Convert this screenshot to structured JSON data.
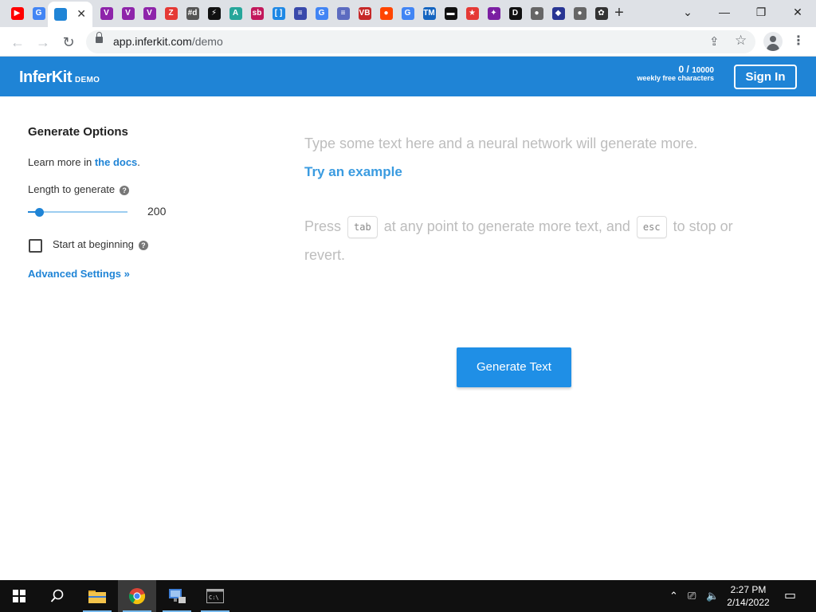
{
  "browser": {
    "url_domain": "app.inferkit.com",
    "url_path": "/demo",
    "tabs": [
      {
        "icon": "youtube-icon",
        "glyph": "▶",
        "color": "#ff0000"
      },
      {
        "icon": "google-icon",
        "glyph": "G",
        "color": "#4285f4"
      },
      {
        "icon": "inferkit-icon",
        "glyph": "",
        "color": "#1f84d6",
        "active": true
      },
      {
        "icon": "v-icon",
        "glyph": "V",
        "color": "#8e24aa"
      },
      {
        "icon": "v-icon",
        "glyph": "V",
        "color": "#8e24aa"
      },
      {
        "icon": "v-icon",
        "glyph": "V",
        "color": "#8e24aa"
      },
      {
        "icon": "z-icon",
        "glyph": "Z",
        "color": "#e53935"
      },
      {
        "icon": "hashtag-icon",
        "glyph": "#d",
        "color": "#555"
      },
      {
        "icon": "bolt-icon",
        "glyph": "⚡",
        "color": "#111"
      },
      {
        "icon": "a-icon",
        "glyph": "A",
        "color": "#26a69a"
      },
      {
        "icon": "sb-icon",
        "glyph": "sb",
        "color": "#c2185b"
      },
      {
        "icon": "brackets-icon",
        "glyph": "[ ]",
        "color": "#1e88e5"
      },
      {
        "icon": "doc-icon",
        "glyph": "≡",
        "color": "#3949ab"
      },
      {
        "icon": "google-icon",
        "glyph": "G",
        "color": "#4285f4"
      },
      {
        "icon": "doc-icon",
        "glyph": "≡",
        "color": "#5c6bc0"
      },
      {
        "icon": "vb-icon",
        "glyph": "VB",
        "color": "#c62828"
      },
      {
        "icon": "reddit-icon",
        "glyph": "●",
        "color": "#ff4500"
      },
      {
        "icon": "google-icon",
        "glyph": "G",
        "color": "#4285f4"
      },
      {
        "icon": "tm-icon",
        "glyph": "TM",
        "color": "#1565c0"
      },
      {
        "icon": "terminal-icon",
        "glyph": "▬",
        "color": "#111"
      },
      {
        "icon": "star-icon",
        "glyph": "★",
        "color": "#e53935"
      },
      {
        "icon": "unicorn-icon",
        "glyph": "✦",
        "color": "#7b1fa2"
      },
      {
        "icon": "d-icon",
        "glyph": "D",
        "color": "#111"
      },
      {
        "icon": "globe-icon",
        "glyph": "●",
        "color": "#666"
      },
      {
        "icon": "ninja-icon",
        "glyph": "◆",
        "color": "#283593"
      },
      {
        "icon": "globe-icon",
        "glyph": "●",
        "color": "#666"
      },
      {
        "icon": "openai-icon",
        "glyph": "✿",
        "color": "#333"
      }
    ],
    "close_glyph": "✕",
    "new_tab_glyph": "+",
    "window_controls": {
      "chevron": "⌄",
      "minimize": "—",
      "restore": "❐",
      "close": "✕"
    },
    "nav": {
      "back": "←",
      "forward": "→",
      "reload": "↻"
    },
    "share_glyph": "⇪",
    "bookmark_glyph": "☆",
    "menu_glyph": "⋮"
  },
  "header": {
    "brand": "InferKit",
    "brand_sub": "DEMO",
    "quota_used": "0",
    "quota_total": "10000",
    "quota_label": "weekly free characters",
    "signin_label": "Sign In"
  },
  "options": {
    "title": "Generate Options",
    "learn_prefix": "Learn more in ",
    "learn_link": "the docs",
    "learn_suffix": ".",
    "length_label": "Length to generate",
    "length_value": "200",
    "length_fraction": 0.1,
    "help_glyph": "?",
    "start_label": "Start at beginning",
    "start_checked": false,
    "advanced_label": "Advanced Settings »"
  },
  "editor": {
    "placeholder": "Type some text here and a neural network will generate more.",
    "try_example": "Try an example",
    "hint_press": "Press",
    "hint_key1": "tab",
    "hint_middle": "at any point to generate more text, and",
    "hint_key2": "esc",
    "hint_end": "to stop or revert.",
    "generate_label": "Generate Text"
  },
  "taskbar": {
    "start": "start-icon",
    "search": "search-icon",
    "apps": [
      {
        "name": "file-explorer-icon",
        "color": "#f3c34b"
      },
      {
        "name": "chrome-icon",
        "color": "#4caf50",
        "active": true
      },
      {
        "name": "network-icon",
        "color": "#3f7fd6"
      },
      {
        "name": "terminal-icon",
        "color": "#222"
      }
    ],
    "tray": {
      "chevron": "⌃",
      "network": "⎚",
      "volume": "🔈"
    },
    "time": "2:27 PM",
    "date": "2/14/2022",
    "notifications": "▭"
  },
  "colors": {
    "brand_blue": "#1f84d6",
    "button_blue": "#1f8fe6",
    "link_blue": "#3a9be0"
  }
}
